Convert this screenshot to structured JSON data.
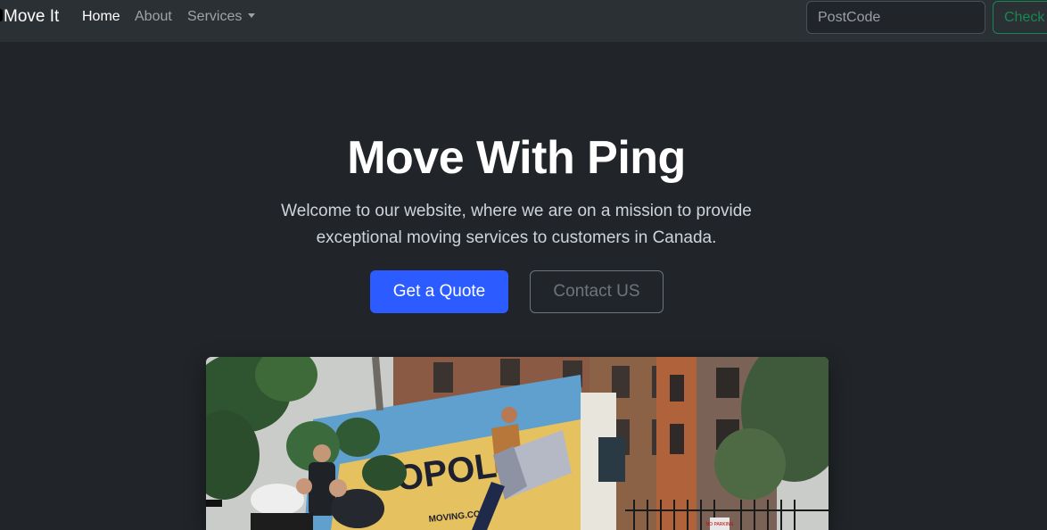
{
  "navbar": {
    "brand": "Move It",
    "links": [
      {
        "label": "Home",
        "active": true
      },
      {
        "label": "About",
        "active": false
      },
      {
        "label": "Services",
        "active": false
      }
    ],
    "postcode_placeholder": "PostCode",
    "check_label": "Check"
  },
  "hero": {
    "title": "Move With Ping",
    "lead": "Welcome to our website, where we are on a mission to provide exceptional moving services to customers in Canada.",
    "primary_button": "Get a Quote",
    "secondary_button": "Contact US",
    "truck_text": "OPOLIS",
    "truck_site": "MOVING.COM",
    "sign_text": "NO PARKING"
  },
  "colors": {
    "page_bg": "#212529",
    "navbar_bg": "#2b3035",
    "primary": "#2c5cff",
    "success": "#198754",
    "secondary": "#6c757d"
  }
}
